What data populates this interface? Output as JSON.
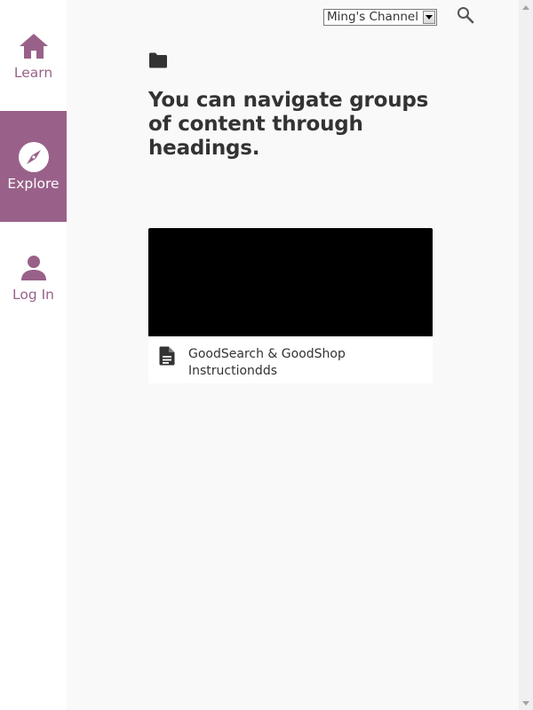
{
  "sidebar": {
    "items": [
      {
        "label": "Learn",
        "icon": "home-icon",
        "active": false
      },
      {
        "label": "Explore",
        "icon": "compass-icon",
        "active": true
      },
      {
        "label": "Log In",
        "icon": "person-icon",
        "active": false
      }
    ]
  },
  "toolbar": {
    "channel_select_value": "Ming's Channel",
    "search_icon": "search-icon"
  },
  "main": {
    "folder_icon": "folder-icon",
    "title": "You can navigate groups of content through headings.",
    "cards": [
      {
        "title": "GoodSearch & GoodShop Instructiondds",
        "icon": "document-icon"
      }
    ]
  },
  "colors": {
    "brand": "#996189",
    "main_bg": "#f9f9f9",
    "text": "#333333",
    "thumbnail": "#000000"
  }
}
